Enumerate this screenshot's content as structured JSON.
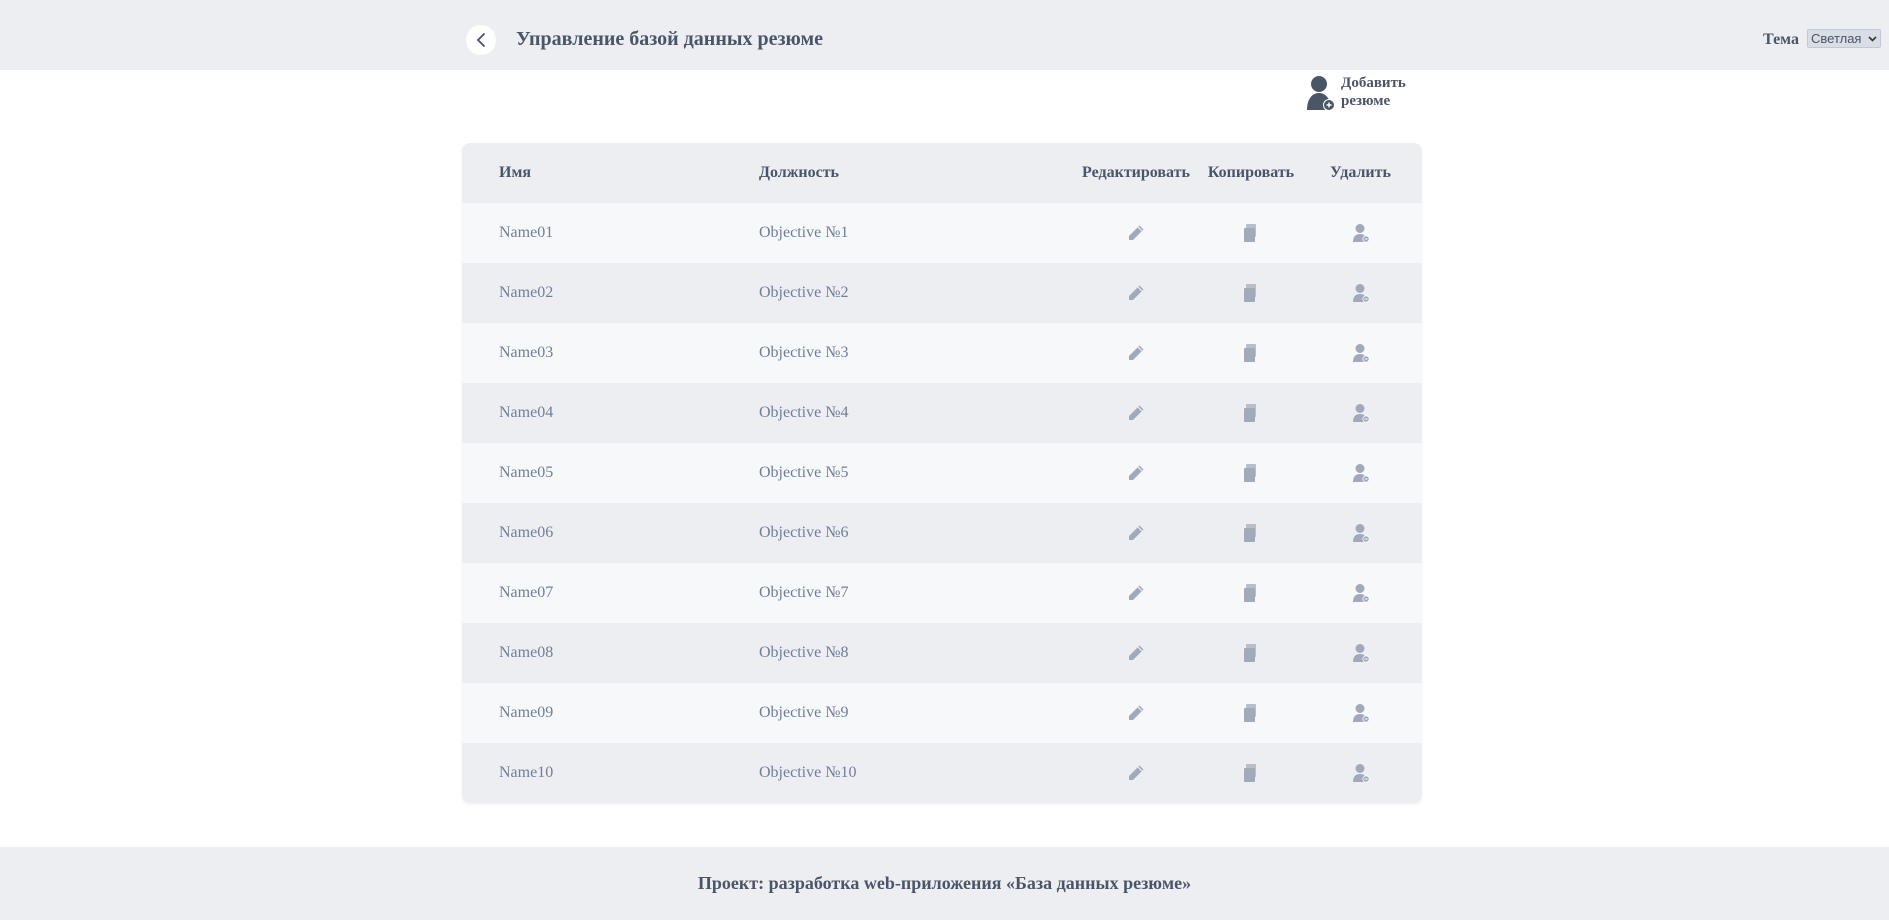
{
  "header": {
    "back_icon": "chevron-left-icon",
    "title": "Управление базой данных резюме",
    "theme_label": "Тема",
    "theme_selected": "Светлая"
  },
  "actions": {
    "add_resume_icon": "add-user-icon",
    "add_resume_label": "Добавить резюме"
  },
  "table": {
    "columns": [
      "Имя",
      "Должность",
      "Редактировать",
      "Копировать",
      "Удалить"
    ],
    "rows": [
      {
        "name": "Name01",
        "objective": "Objective №1"
      },
      {
        "name": "Name02",
        "objective": "Objective №2"
      },
      {
        "name": "Name03",
        "objective": "Objective №3"
      },
      {
        "name": "Name04",
        "objective": "Objective №4"
      },
      {
        "name": "Name05",
        "objective": "Objective №5"
      },
      {
        "name": "Name06",
        "objective": "Objective №6"
      },
      {
        "name": "Name07",
        "objective": "Objective №7"
      },
      {
        "name": "Name08",
        "objective": "Objective №8"
      },
      {
        "name": "Name09",
        "objective": "Objective №9"
      },
      {
        "name": "Name10",
        "objective": "Objective №10"
      }
    ],
    "row_icons": {
      "edit": "pencil-icon",
      "copy": "copy-icon",
      "delete": "remove-user-icon"
    }
  },
  "footer": {
    "text": "Проект: разработка web-приложения «База данных резюме»"
  },
  "colors": {
    "bar_bg": "#eceef2",
    "row_alt": "#f7f8fa",
    "text_dark": "#4a5568",
    "text_muted": "#6f7f99",
    "icon": "#a0aab9"
  }
}
